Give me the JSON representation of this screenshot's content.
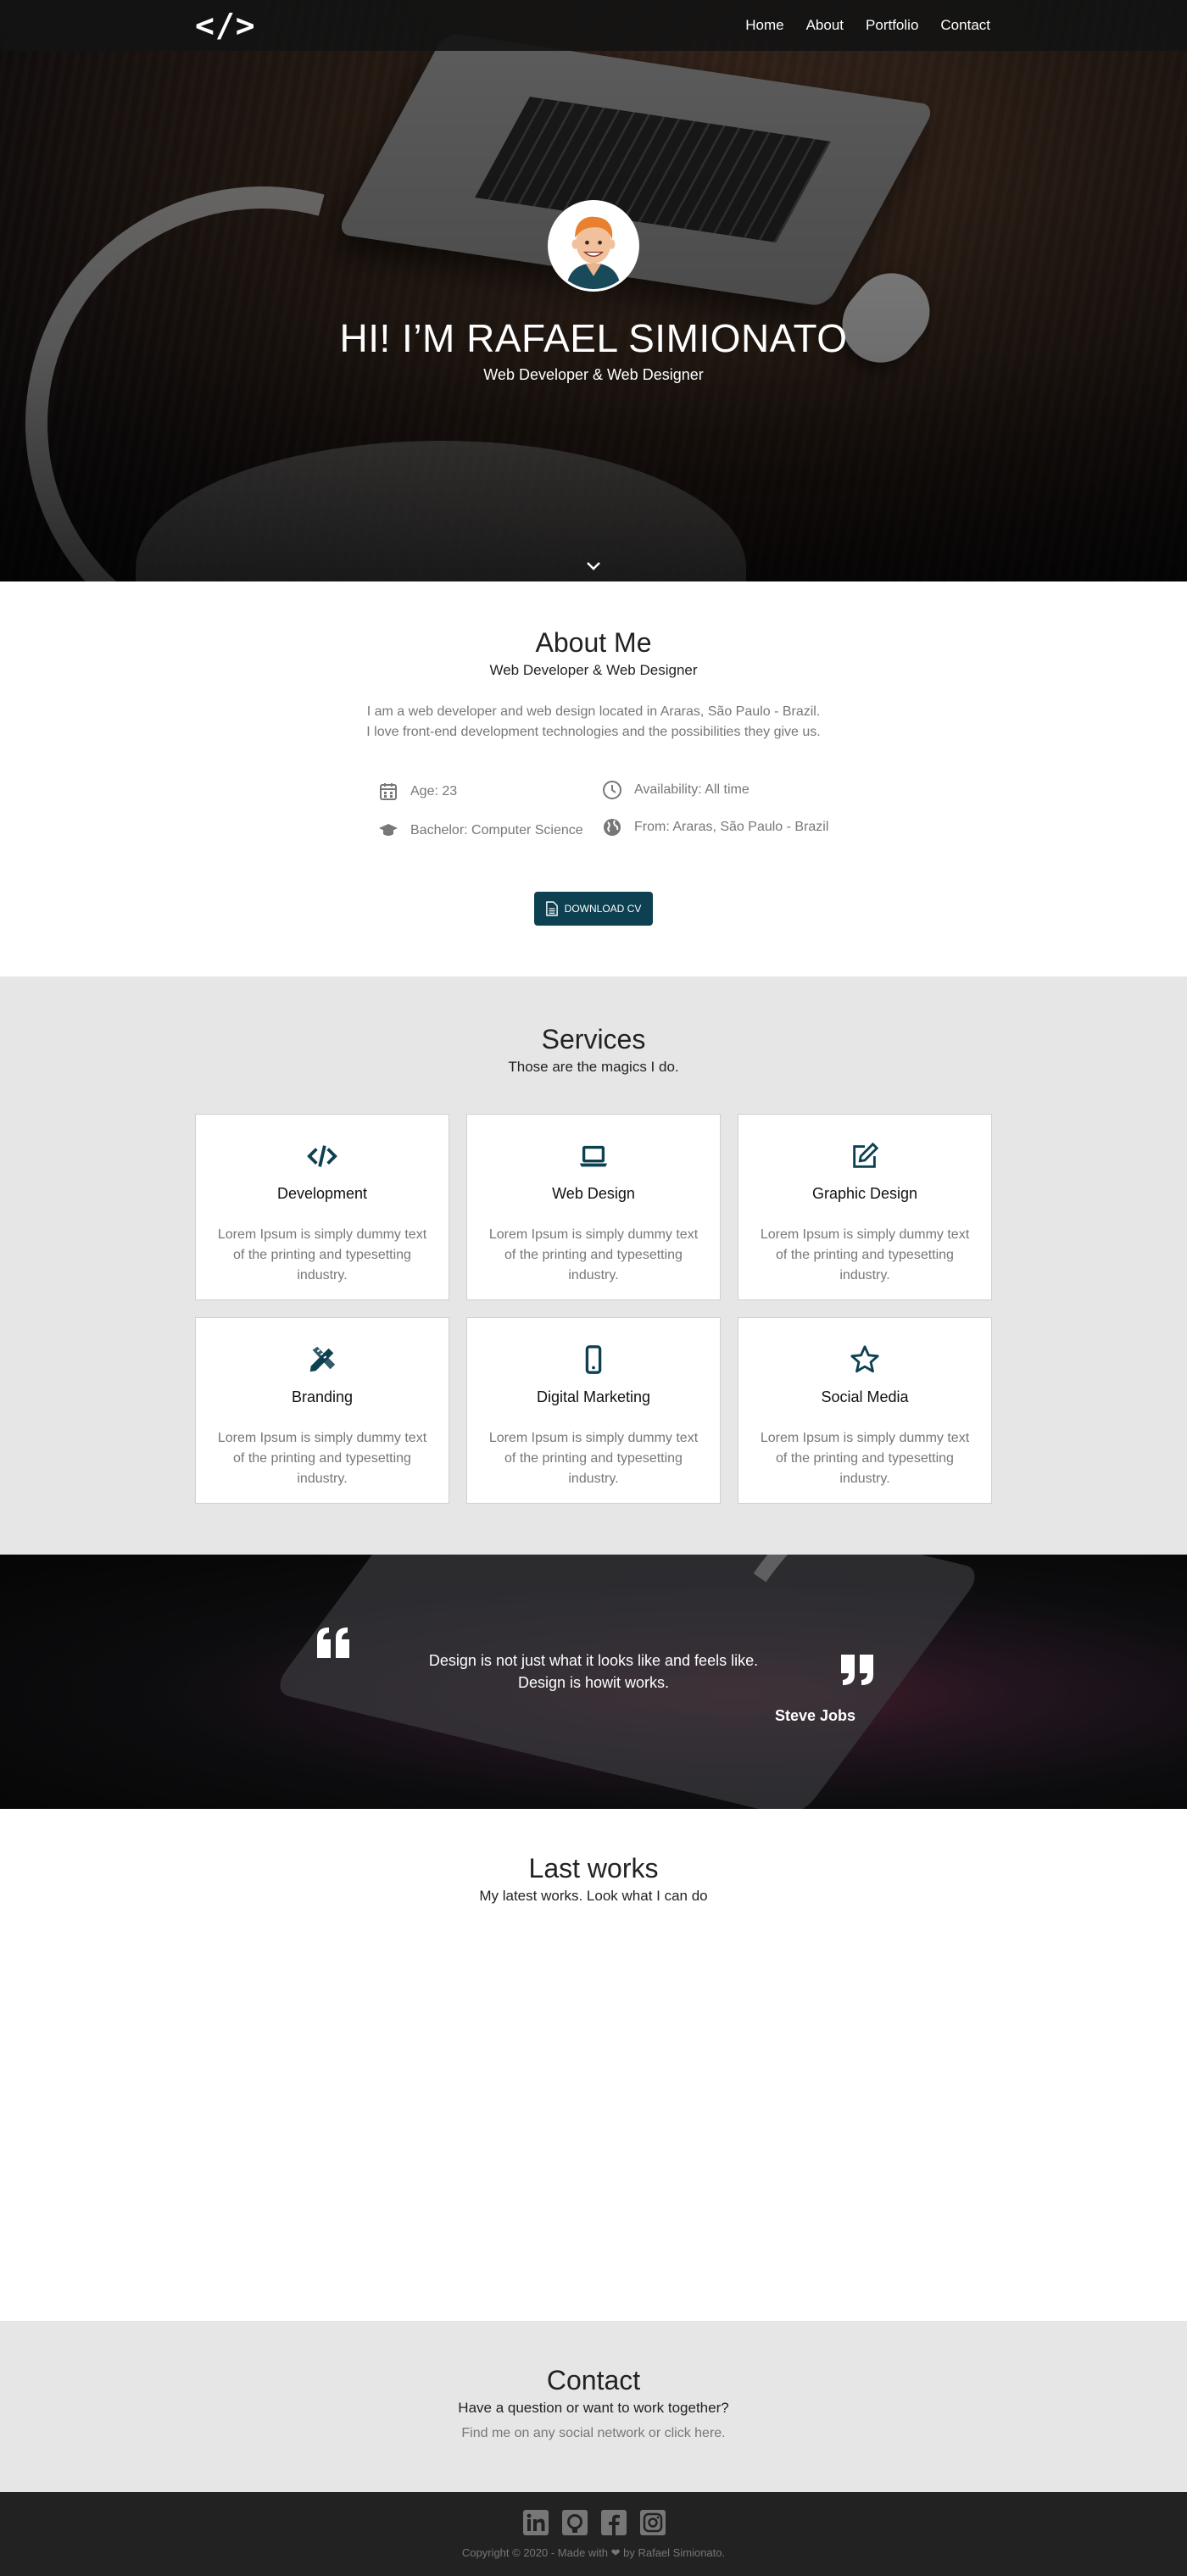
{
  "nav": {
    "logo": "</>",
    "links": [
      "Home",
      "About",
      "Portfolio",
      "Contact"
    ]
  },
  "hero": {
    "title": "HI! I’M RAFAEL SIMIONATO",
    "subtitle": "Web Developer & Web Designer",
    "avatar_icon": "avatar-illustration",
    "scroll_icon": "chevron-down-icon"
  },
  "about": {
    "title": "About Me",
    "subtitle": "Web Developer & Web Designer",
    "desc_line1": "I am a web developer and web design located in Araras, São Paulo - Brazil.",
    "desc_line2": "I love front-end development technologies and the possibilities they give us.",
    "info": {
      "age": "Age: 23",
      "availability": "Availability: All time",
      "education": "Bachelor: Computer Science",
      "from": "From: Araras, São Paulo - Brazil"
    },
    "download_label": "DOWNLOAD CV"
  },
  "services": {
    "title": "Services",
    "subtitle": "Those are the magics I do.",
    "items": [
      {
        "title": "Development",
        "text": "Lorem Ipsum is simply dummy text of the printing and typesetting industry.",
        "icon": "code-icon"
      },
      {
        "title": "Web Design",
        "text": "Lorem Ipsum is simply dummy text of the printing and typesetting industry.",
        "icon": "laptop-icon"
      },
      {
        "title": "Graphic Design",
        "text": "Lorem Ipsum is simply dummy text of the printing and typesetting industry.",
        "icon": "edit-icon"
      },
      {
        "title": "Branding",
        "text": "Lorem Ipsum is simply dummy text of the printing and typesetting industry.",
        "icon": "pencil-ruler-icon"
      },
      {
        "title": "Digital Marketing",
        "text": "Lorem Ipsum is simply dummy text of the printing and typesetting industry.",
        "icon": "mobile-icon"
      },
      {
        "title": "Social Media",
        "text": "Lorem Ipsum is simply dummy text of the printing and typesetting industry.",
        "icon": "star-icon"
      }
    ]
  },
  "quote": {
    "line1": "Design is not just what it looks like and feels like.",
    "line2": "Design is howit works.",
    "author": "Steve Jobs"
  },
  "works": {
    "title": "Last works",
    "subtitle": "My latest works. Look what I can do"
  },
  "contact": {
    "title": "Contact",
    "subtitle": "Have a question or want to work together?",
    "note": "Find me on any social network or click here."
  },
  "footer": {
    "social": [
      "linkedin-icon",
      "github-icon",
      "facebook-icon",
      "instagram-icon"
    ],
    "copyright": "Copyright © 2020 - Made with ❤ by Rafael Simionato."
  },
  "colors": {
    "accent": "#0d4050",
    "section_gray": "#e6e6e6",
    "footer": "#222222",
    "muted_text": "#777777"
  }
}
